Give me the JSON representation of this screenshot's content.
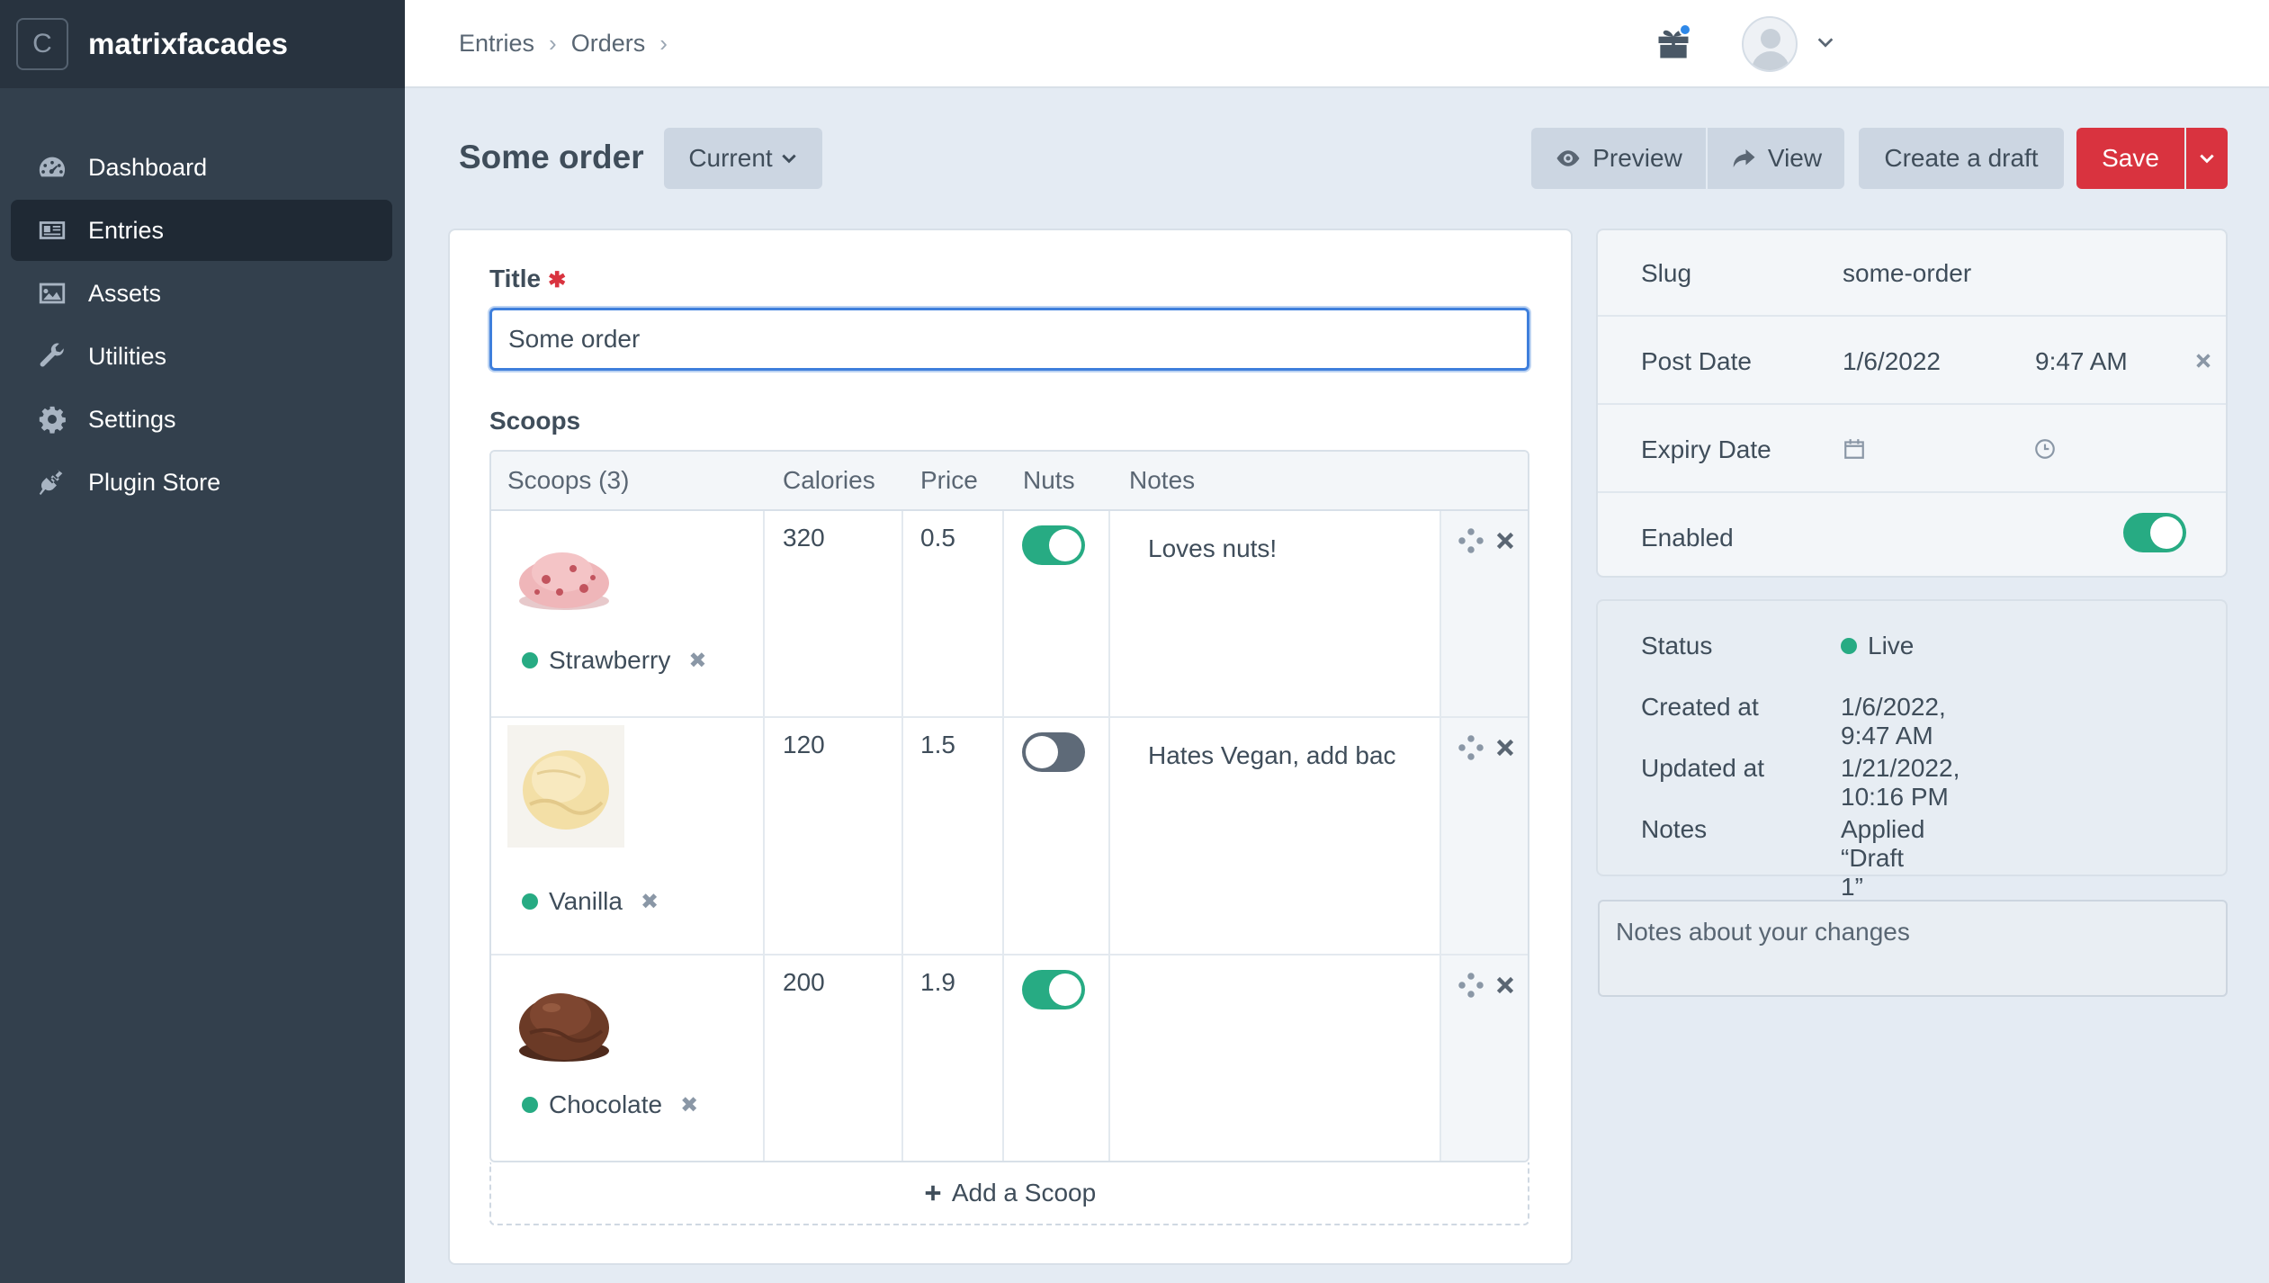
{
  "sidebar": {
    "site_badge": "C",
    "site_name": "matrixfacades",
    "items": [
      {
        "label": "Dashboard",
        "icon": "dashboard-icon"
      },
      {
        "label": "Entries",
        "icon": "entries-icon",
        "active": true
      },
      {
        "label": "Assets",
        "icon": "image-icon"
      },
      {
        "label": "Utilities",
        "icon": "wrench-icon"
      },
      {
        "label": "Settings",
        "icon": "gear-icon"
      },
      {
        "label": "Plugin Store",
        "icon": "plug-icon"
      }
    ]
  },
  "breadcrumb": [
    "Entries",
    "Orders"
  ],
  "header": {
    "title": "Some order",
    "revision_label": "Current",
    "preview_label": "Preview",
    "view_label": "View",
    "draft_label": "Create a draft",
    "save_label": "Save"
  },
  "form": {
    "title_label": "Title",
    "title_value": "Some order",
    "scoops_label": "Scoops",
    "columns": [
      "Scoops (3)",
      "Calories",
      "Price",
      "Nuts",
      "Notes"
    ],
    "rows": [
      {
        "name": "Strawberry",
        "calories": "320",
        "price": "0.5",
        "nuts": true,
        "notes": "Loves nuts!"
      },
      {
        "name": "Vanilla",
        "calories": "120",
        "price": "1.5",
        "nuts": false,
        "notes": "Hates Vegan, add bac"
      },
      {
        "name": "Chocolate",
        "calories": "200",
        "price": "1.9",
        "nuts": true,
        "notes": ""
      }
    ],
    "add_label": "Add a Scoop"
  },
  "meta": {
    "slug_label": "Slug",
    "slug_value": "some-order",
    "post_date_label": "Post Date",
    "post_date": "1/6/2022",
    "post_time": "9:47 AM",
    "expiry_label": "Expiry Date",
    "enabled_label": "Enabled",
    "enabled": true
  },
  "status": {
    "status_label": "Status",
    "status_value": "Live",
    "created_label": "Created at",
    "created_value": "1/6/2022, 9:47 AM",
    "updated_label": "Updated at",
    "updated_value": "1/21/2022, 10:16 PM",
    "notes_label": "Notes",
    "notes_value": "Applied “Draft 1”"
  },
  "notes_placeholder": "Notes about your changes",
  "colors": {
    "accent": "#d9333f",
    "live": "#27ab83",
    "focus": "#3f7fdc"
  }
}
